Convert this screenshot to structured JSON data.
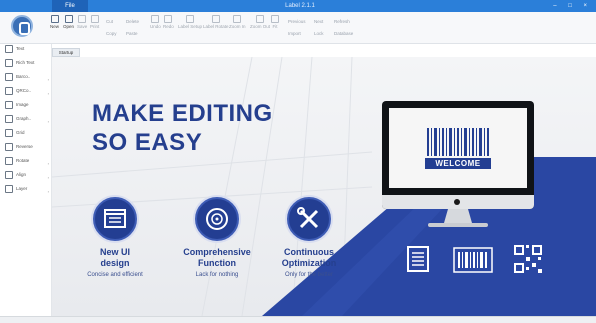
{
  "window": {
    "file_tab": "File",
    "title": "Label 2.1.1",
    "controls": "–  □  ×"
  },
  "ribbon": {
    "main_tools": [
      {
        "name": "new-tool",
        "label": "New",
        "dim": false
      },
      {
        "name": "open-tool",
        "label": "Open",
        "dim": false
      },
      {
        "name": "save-tool",
        "label": "Save",
        "dim": true
      },
      {
        "name": "print-tool",
        "label": "Print",
        "dim": true
      }
    ],
    "edit_small": [
      "Cut",
      "Copy",
      "Delete",
      "Paste"
    ],
    "history_tools": [
      "Undo",
      "Redo",
      "Label Setup",
      "Label Rotate",
      "Zoom In",
      "Zoom Out",
      "Fit"
    ],
    "right_small": [
      "Previous",
      "Next",
      "Refresh",
      "Import",
      "Lock",
      "Database"
    ]
  },
  "sidebar": {
    "items": [
      "Text",
      "Rich Text",
      "Barco..",
      "QRCo..",
      "Image",
      "Graph..",
      "Grid",
      "Reverse",
      "Rotate",
      "Align",
      "Layer"
    ]
  },
  "doc_tab": "Startup Page",
  "welcome": {
    "headline_1": "MAKE EDITING",
    "headline_2": "SO EASY",
    "monitor_label": "WELCOME",
    "features": [
      {
        "title_1": "New UI",
        "title_2": "design",
        "subtitle": "Concise and efficient"
      },
      {
        "title_1": "Comprehensive",
        "title_2": "Function",
        "subtitle": "Lack for nothing"
      },
      {
        "title_1": "Continuous",
        "title_2": "Optimization",
        "subtitle": "Only for the better"
      }
    ]
  },
  "colors": {
    "brand_blue": "#2b4aa6",
    "title_blue": "#253f8e",
    "titlebar": "#2b7fd9"
  }
}
